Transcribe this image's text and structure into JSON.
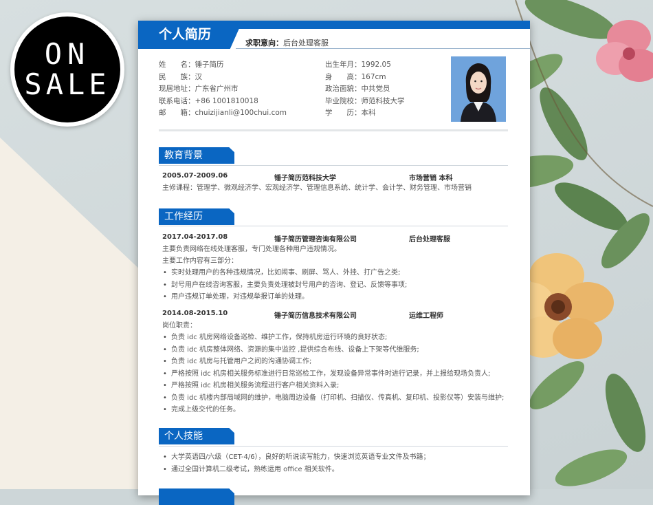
{
  "badge": {
    "line1": "ON",
    "line2": "SALE"
  },
  "resume": {
    "title": "个人简历",
    "objective_label": "求职意向：",
    "objective_value": "后台处理客服",
    "info_left": [
      {
        "key": "姓　　名：",
        "value": "锤子简历"
      },
      {
        "key": "民　　族：",
        "value": "汉"
      },
      {
        "key": "现居地址：",
        "value": "广东省广州市"
      },
      {
        "key": "联系电话：",
        "value": "+86 1001810018"
      },
      {
        "key": "邮　　箱：",
        "value": "chuizijianli@100chui.com"
      }
    ],
    "info_right": [
      {
        "key": "出生年月：",
        "value": "1992.05"
      },
      {
        "key": "身　　高：",
        "value": "167cm"
      },
      {
        "key": "政治面貌：",
        "value": "中共党员"
      },
      {
        "key": "毕业院校：",
        "value": "师范科技大学"
      },
      {
        "key": "学　　历：",
        "value": "本科"
      }
    ],
    "education": {
      "heading": "教育背景",
      "period": "2005.07-2009.06",
      "school": "锤子简历范科技大学",
      "major": "市场营销  本科",
      "courses": "主修课程：管理学、微观经济学、宏观经济学、管理信息系统、统计学、会计学、财务管理、市场营销"
    },
    "work": {
      "heading": "工作经历",
      "jobs": [
        {
          "period": "2017.04-2017.08",
          "company": "锤子简历管理咨询有限公司",
          "role": "后台处理客服",
          "lines": [
            "主要负责网络在线处理客服，专门处理各种用户违规情况。",
            "主要工作内容有三部分："
          ],
          "bullets": [
            "实时处理用户的各种违规情况，比如闹事、刷屏、骂人、外挂、打广告之类;",
            "封号用户在线咨询客服，主要负责处理被封号用户的咨询、登记、反馈等事项;",
            "用户违规订单处理，对违规举报订单的处理。"
          ]
        },
        {
          "period": "2014.08-2015.10",
          "company": "锤子简历信息技术有限公司",
          "role": "运维工程师",
          "lines": [
            "岗位职责："
          ],
          "bullets": [
            "负责 idc 机房网络设备巡检、维护工作，保持机房运行环境的良好状态;",
            "负责 idc 机房整体网络、资源的集中监控 ,提供综合布线、设备上下架等代维服务;",
            "负责 idc 机房与托管用户之间的沟通协调工作;",
            "严格按照 idc 机房相关服务标准进行日常巡检工作，发现设备异常事件时进行记录，并上报给现场负责人;",
            "严格按照 idc 机房相关服务流程进行客户相关资料入录;",
            "负责 idc 机楼内部局域网的维护，电脑周边设备（打印机、扫描仪、传真机、复印机、投影仪等）安装与维护;",
            "完成上级交代的任务。"
          ]
        }
      ]
    },
    "skills": {
      "heading": "个人技能",
      "bullets": [
        "大学英语四/六级（CET-4/6），良好的听说读写能力，快速浏览英语专业文件及书籍；",
        "通过全国计算机二级考试，熟练运用 office 相关软件。"
      ]
    }
  }
}
